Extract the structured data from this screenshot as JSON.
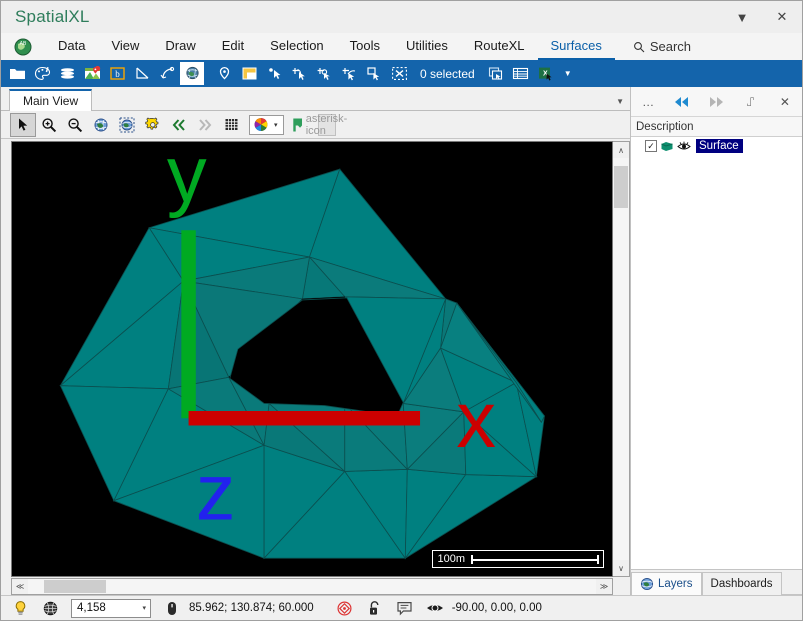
{
  "window": {
    "title": "SpatialXL",
    "minimize_label": "▼",
    "close_label": "✕"
  },
  "menubar": {
    "logo_icon": "globe-logo-icon",
    "items": [
      {
        "label": "Data",
        "active": false
      },
      {
        "label": "View",
        "active": false
      },
      {
        "label": "Draw",
        "active": false
      },
      {
        "label": "Edit",
        "active": false
      },
      {
        "label": "Selection",
        "active": false
      },
      {
        "label": "Tools",
        "active": false
      },
      {
        "label": "Utilities",
        "active": false
      },
      {
        "label": "RouteXL",
        "active": false
      },
      {
        "label": "Surfaces",
        "active": true
      }
    ],
    "search_label": "Search",
    "search_icon": "search-icon"
  },
  "ribbon": {
    "icons": [
      "open-folder-icon",
      "palette-icon",
      "layers-stack-icon",
      "map-pin-image-icon",
      "boundary-box-icon",
      "measure-angle-icon",
      "curve-node-icon",
      "globe-3d-icon",
      "location-pin-icon",
      "note-window-icon",
      "select-point-icon",
      "add-vertex-icon",
      "add-node-icon",
      "add-edge-icon",
      "trim-surface-icon",
      "delete-selection-icon"
    ],
    "selected_index": 7,
    "selection_status": "0 selected",
    "right_icons": [
      "copy-to-clipboard-icon",
      "table-view-icon",
      "export-excel-icon"
    ],
    "overflow_caret": "▼"
  },
  "document": {
    "tabs": [
      {
        "label": "Main View",
        "active": true
      }
    ],
    "tabs_overflow_caret": "▼"
  },
  "view_toolbar": {
    "tools": [
      {
        "icon": "arrow-select-icon",
        "pressed": true
      },
      {
        "icon": "zoom-in-icon",
        "pressed": false
      },
      {
        "icon": "zoom-out-icon",
        "pressed": false
      },
      {
        "icon": "zoom-extents-globe-icon",
        "pressed": false
      },
      {
        "icon": "zoom-selection-globe-icon",
        "pressed": false
      },
      {
        "icon": "settings-gear-icon",
        "pressed": false
      },
      {
        "icon": "previous-view-icon",
        "pressed": false
      },
      {
        "icon": "next-view-icon",
        "pressed": false
      },
      {
        "icon": "grid-icon",
        "pressed": false
      }
    ],
    "color_picker_icon": "color-palette-icon",
    "color_picker_caret": "▾",
    "flag_icon": "green-flag-icon",
    "disabled_icon": "asterisk-icon"
  },
  "viewport": {
    "background_color": "#000000",
    "mesh_color": "#008080",
    "mesh_edge_color": "#044a4a",
    "axis": {
      "x_label": "x",
      "y_label": "y",
      "z_label": "z",
      "x_color": "#cc0000",
      "y_color": "#00aa22",
      "z_color": "#2222ee"
    },
    "scalebar": {
      "label": "100m"
    },
    "vscroll": {
      "up": "∧",
      "down": "∨"
    },
    "hscroll": {
      "left": "≪",
      "right": "≫"
    }
  },
  "right_panel": {
    "header_buttons": [
      {
        "icon": "more-options-icon",
        "label": "…"
      },
      {
        "icon": "collapse-left-icon",
        "label": "◀◀"
      },
      {
        "icon": "expand-right-icon",
        "label": "▶▶"
      },
      {
        "icon": "pin-icon",
        "label": "⑀"
      },
      {
        "icon": "close-panel-icon",
        "label": "✕"
      }
    ],
    "column_header": "Description",
    "layers": [
      {
        "name": "Surface",
        "checked": true,
        "check_glyph": "✓",
        "layer_icon": "layer-shape-icon",
        "visibility_icon": "eye-icon",
        "selected": true
      }
    ],
    "tabs": [
      {
        "label": "Layers",
        "icon": "globe-icon",
        "active": true
      },
      {
        "label": "Dashboards",
        "icon": "",
        "active": false
      }
    ]
  },
  "statusbar": {
    "lightbulb_icon": "lightbulb-icon",
    "globe_icon": "globe-wire-icon",
    "zoom_value": "4,158",
    "zoom_caret": "▾",
    "mouse_icon": "mouse-icon",
    "coordinates": "85.962; 130.874; 60.000",
    "target_icon": "target-icon",
    "lock_icon": "unlock-icon",
    "note_icon": "note-icon",
    "eye_icon": "eye-icon",
    "orientation": "-90.00, 0.00, 0.00"
  }
}
